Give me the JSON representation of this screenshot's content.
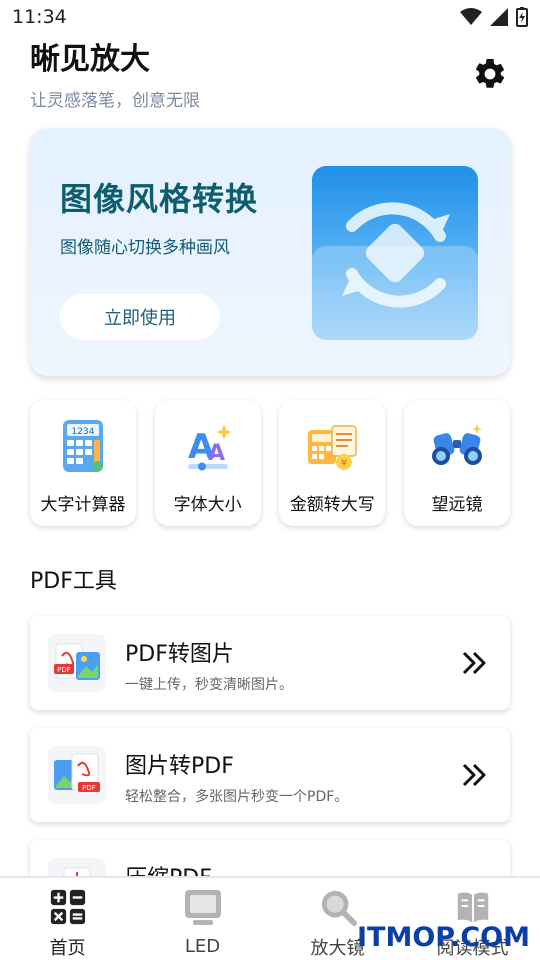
{
  "status_bar": {
    "time": "11:34",
    "icons": [
      "wifi-icon",
      "signal-icon",
      "battery-charging-icon"
    ]
  },
  "header": {
    "title": "晰见放大",
    "subtitle": "让灵感落笔，创意无限",
    "settings_icon": "gear-icon"
  },
  "hero": {
    "title": "图像风格转换",
    "description": "图像随心切换多种画风",
    "button_label": "立即使用",
    "icon": "swap-arrows-icon"
  },
  "quick_tools": [
    {
      "label": "大字计算器",
      "icon": "calculator-icon"
    },
    {
      "label": "字体大小",
      "icon": "font-size-icon"
    },
    {
      "label": "金额转大写",
      "icon": "money-convert-icon"
    },
    {
      "label": "望远镜",
      "icon": "binoculars-icon"
    }
  ],
  "pdf_section": {
    "title": "PDF工具",
    "items": [
      {
        "title": "PDF转图片",
        "description": "一键上传，秒变清晰图片。",
        "icon": "pdf-to-image-icon"
      },
      {
        "title": "图片转PDF",
        "description": "轻松整合，多张图片秒变一个PDF。",
        "icon": "image-to-pdf-icon"
      },
      {
        "title": "压缩PDF",
        "description": "",
        "icon": "compress-pdf-icon"
      }
    ]
  },
  "bottom_nav": [
    {
      "label": "首页",
      "icon": "grid-calculator-icon"
    },
    {
      "label": "LED",
      "icon": "monitor-icon"
    },
    {
      "label": "放大镜",
      "icon": "magnifier-icon"
    },
    {
      "label": "阅读模式",
      "icon": "book-icon"
    }
  ],
  "watermark": "ITMOP.COM",
  "colors": {
    "hero_title": "#0e5d6e",
    "hero_bg": "#e4f1ff",
    "subtitle": "#7a8aa0",
    "watermark": "#0b3fa8"
  }
}
